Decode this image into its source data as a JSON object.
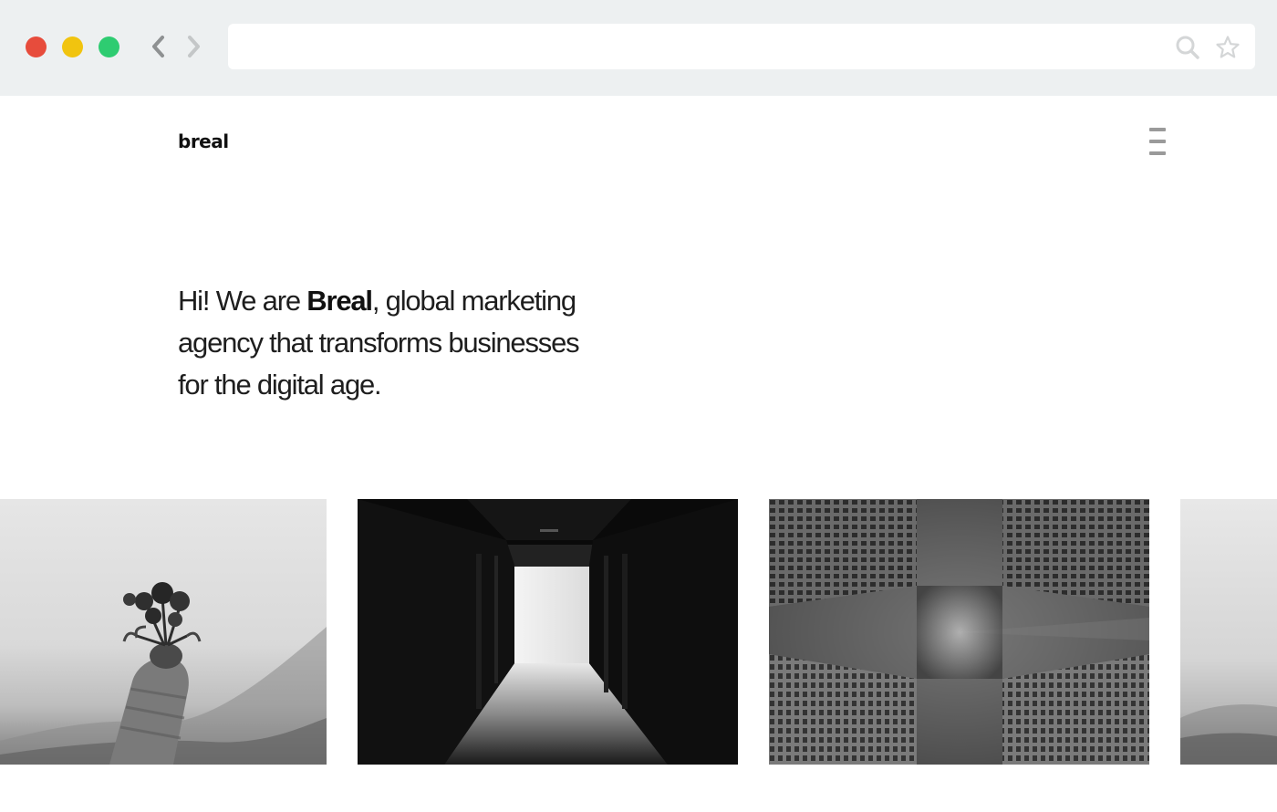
{
  "browser": {
    "traffic_lights": {
      "close": "#e74c3c",
      "minimize": "#f1c40f",
      "maximize": "#2ecc71"
    },
    "back_icon": "chevron-left-icon",
    "forward_icon": "chevron-right-icon",
    "url": "",
    "search_icon": "search-icon",
    "bookmark_icon": "star-icon"
  },
  "site": {
    "logo": "breal",
    "menu_icon": "hamburger-menu-icon"
  },
  "hero": {
    "prefix": "Hi! We are ",
    "brand": "Breal",
    "suffix": ", global marketing agency that transforms businesses for the digital age."
  },
  "gallery": {
    "images": [
      {
        "subject": "hand holding flowers",
        "tone": "grayscale"
      },
      {
        "subject": "dark corridor",
        "tone": "grayscale"
      },
      {
        "subject": "buildings looking up",
        "tone": "grayscale"
      },
      {
        "subject": "hills",
        "tone": "grayscale"
      }
    ]
  }
}
